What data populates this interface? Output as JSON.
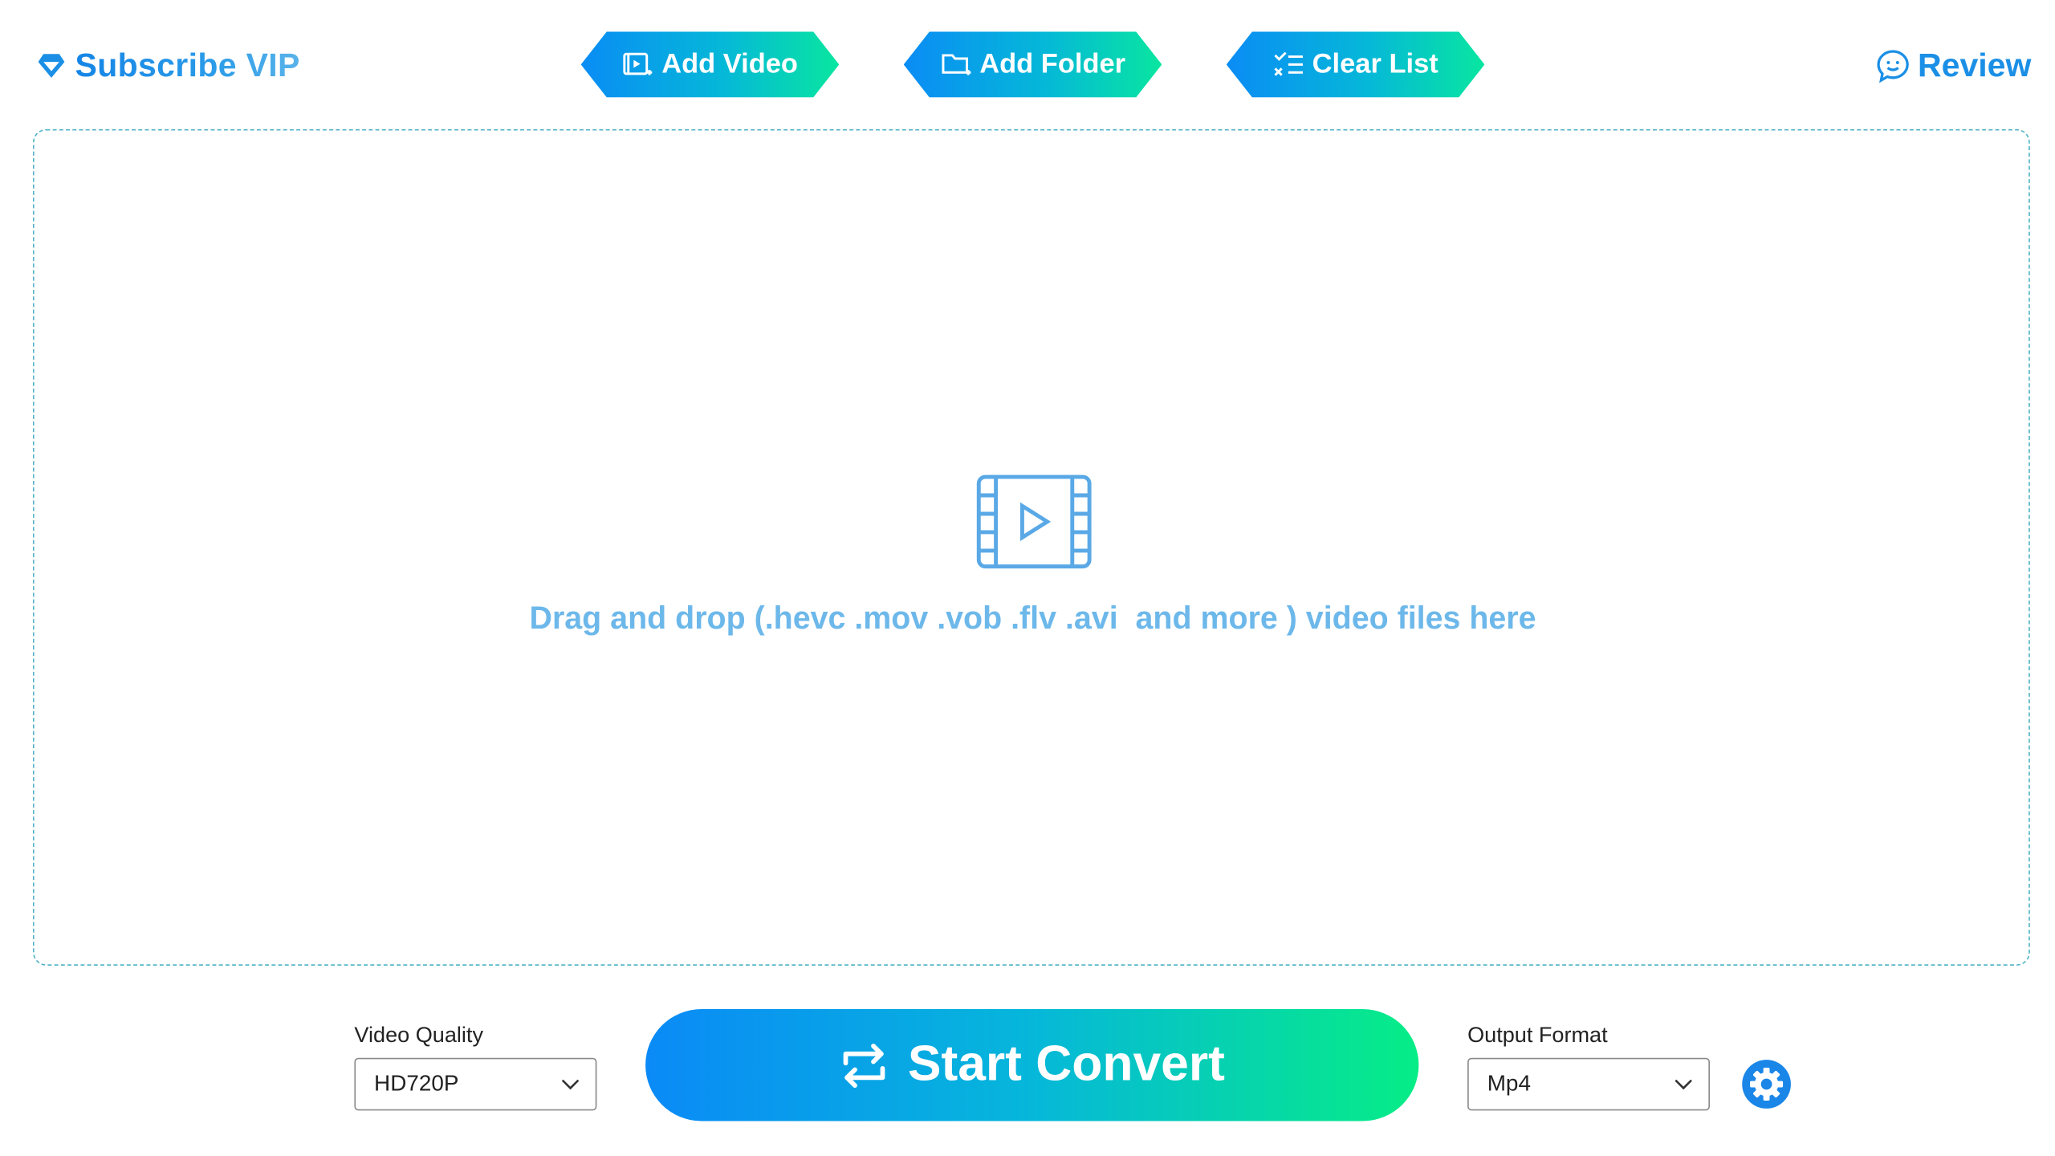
{
  "header": {
    "subscribe_label": "Subscribe VIP",
    "review_label": "Review",
    "buttons": [
      {
        "label": "Add Video",
        "icon": "video-add-icon"
      },
      {
        "label": "Add Folder",
        "icon": "folder-add-icon"
      },
      {
        "label": "Clear List",
        "icon": "clear-list-icon"
      }
    ]
  },
  "dropzone": {
    "text": "Drag and drop (.hevc .mov .vob .flv .avi  and more ) video files here",
    "icon": "film-play-icon"
  },
  "controls": {
    "quality_label": "Video Quality",
    "quality_value": "HD720P",
    "convert_label": "Start Convert",
    "format_label": "Output Format",
    "format_value": "Mp4",
    "settings_icon": "gear-icon"
  },
  "colors": {
    "accent_blue": "#0a8af7",
    "accent_green": "#06ed86",
    "drop_text": "#6db8ea",
    "dash_border": "#4fb3c6"
  }
}
